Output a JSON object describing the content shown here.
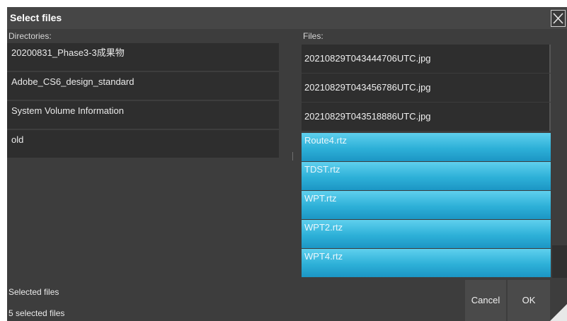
{
  "dialog": {
    "title": "Select files",
    "close_icon": "close-icon"
  },
  "directories": {
    "label": "Directories:",
    "items": [
      "20200831_Phase3-3成果物",
      "Adobe_CS6_design_standard",
      "System Volume Information",
      "old"
    ]
  },
  "files": {
    "label": "Files:",
    "items": [
      {
        "name": "20210829T043444706UTC.jpg",
        "selected": false
      },
      {
        "name": "20210829T043456786UTC.jpg",
        "selected": false
      },
      {
        "name": "20210829T043518886UTC.jpg",
        "selected": false
      },
      {
        "name": "Route4.rtz",
        "selected": true
      },
      {
        "name": "TDST.rtz",
        "selected": true
      },
      {
        "name": "WPT.rtz",
        "selected": true
      },
      {
        "name": "WPT2.rtz",
        "selected": true
      },
      {
        "name": "WPT4.rtz",
        "selected": true
      }
    ]
  },
  "footer": {
    "selected_label": "Selected files",
    "selected_count": "5 selected files",
    "cancel_label": "Cancel",
    "ok_label": "OK"
  },
  "colors": {
    "selection": "#2db0d8",
    "background": "#3d3d3d"
  }
}
